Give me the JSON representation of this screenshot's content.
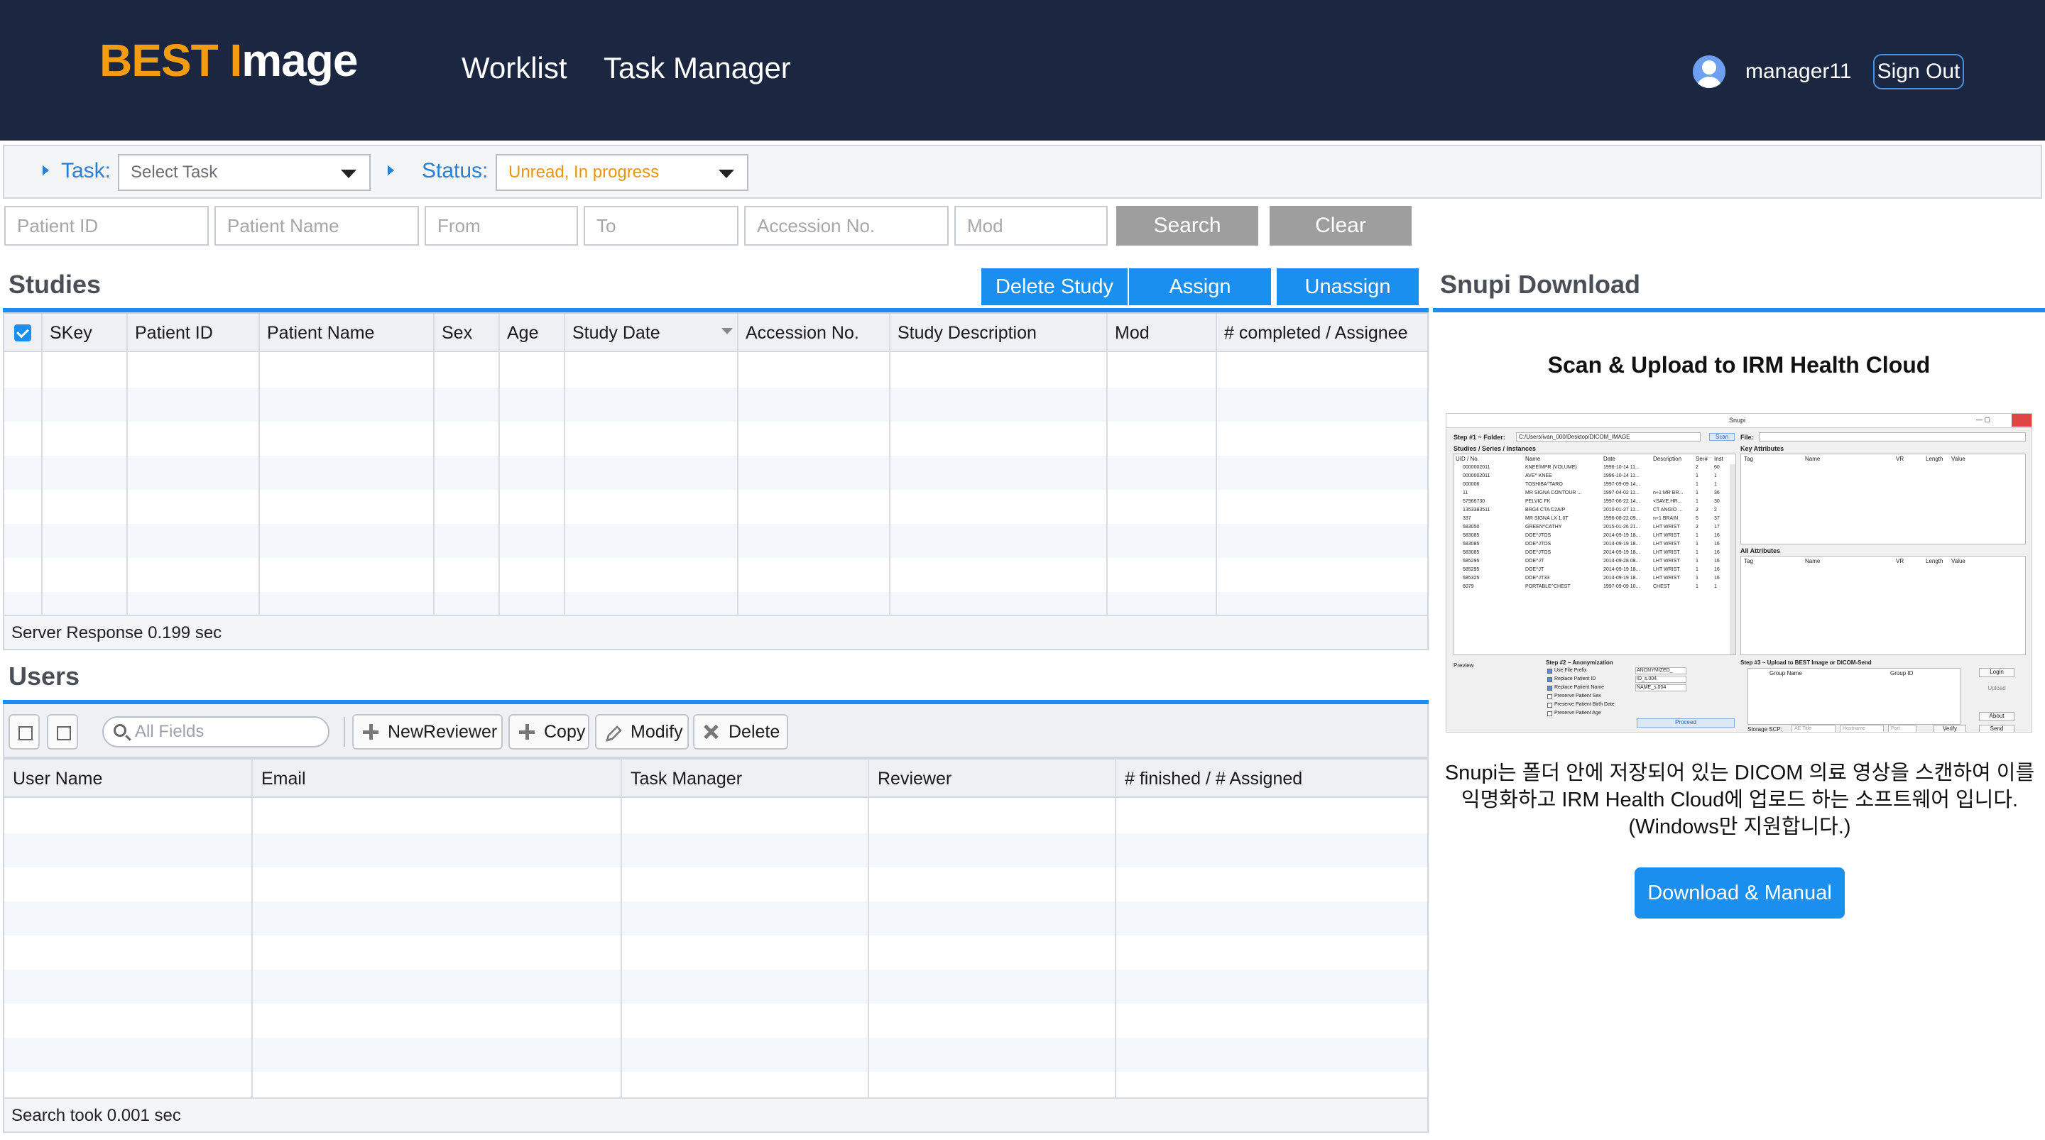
{
  "header": {
    "brand_part1": "BEST I",
    "brand_part2": "mage",
    "nav": [
      "Worklist",
      "Task Manager"
    ],
    "username": "manager11",
    "signout_label": "Sign Out",
    "colors": {
      "background": "#1b2640",
      "brand_orange": "#f39c12",
      "accent_blue": "#1a8ff0"
    }
  },
  "taskbar": {
    "task_label": "Task:",
    "task_value": "Select Task",
    "status_label": "Status:",
    "status_value": "Unread, In progress",
    "status_color": "#e8960c"
  },
  "filters": {
    "patient_id_placeholder": "Patient ID",
    "patient_name_placeholder": "Patient Name",
    "from_placeholder": "From",
    "to_placeholder": "To",
    "accession_placeholder": "Accession No.",
    "mod_placeholder": "Mod",
    "search_label": "Search",
    "clear_label": "Clear"
  },
  "studies": {
    "title": "Studies",
    "buttons": {
      "delete": "Delete Study",
      "assign": "Assign",
      "unassign": "Unassign"
    },
    "columns": [
      "SKey",
      "Patient ID",
      "Patient Name",
      "Sex",
      "Age",
      "Study Date",
      "Accession No.",
      "Study Description",
      "Mod",
      "# completed / Assignee"
    ],
    "footer": "Server Response 0.199 sec"
  },
  "users": {
    "title": "Users",
    "search_placeholder": "All Fields",
    "toolbar": {
      "new_reviewer": "NewReviewer",
      "copy": "Copy",
      "modify": "Modify",
      "delete": "Delete"
    },
    "columns": [
      "User Name",
      "Email",
      "Task Manager",
      "Reviewer",
      "# finished / # Assigned"
    ],
    "footer": "Search took 0.001 sec"
  },
  "snupi": {
    "title": "Snupi Download",
    "heading": "Scan & Upload to IRM Health Cloud",
    "description": "Snupi는 폴더 안에 저장되어 있는 DICOM 의료 영상을 스캔하여 이를 익명화하고 IRM Health Cloud에 업로드 하는 소프트웨어 입니다.(Windows만 지원합니다.)",
    "download_label": "Download & Manual",
    "screenshot": {
      "window_title": "Snupi",
      "step1_label": "Step #1 ~ Folder:",
      "folder_path": "C:/Users/ivan_000/Desktop/DICOM_IMAGE",
      "scan_label": "Scan",
      "file_label": "File:",
      "tree_label": "Studies / Series / Instances",
      "key_attributes": "Key Attributes",
      "all_attributes": "All Attributes",
      "tree_columns": [
        "UID / No.",
        "Name",
        "Date",
        "Description",
        "Ser#",
        "Inst"
      ],
      "attr_columns": [
        "Tag",
        "Name",
        "VR",
        "Length",
        "Value"
      ],
      "rows": [
        [
          "0000002011",
          "KNEE/MPR (VOLUME)",
          "1996-10-14 11...",
          "",
          "2",
          "60"
        ],
        [
          "0000002011",
          "AVE^ KNEE",
          "1996-10-14 11...",
          "",
          "1",
          "1"
        ],
        [
          "000006",
          "TOSHIBA^TARO",
          "1997-09-09 14...",
          "",
          "1",
          "1"
        ],
        [
          "11",
          "MR SIGNA CONTOUR ...",
          "1997-04-02 11...",
          "n+1 MR BR...",
          "1",
          "36"
        ],
        [
          "57966730",
          "PELVIC FK",
          "1997-06-22 14...",
          "<SAVE.HR...",
          "1",
          "30"
        ],
        [
          "1353383511",
          "BRG4 CTA C2A/P",
          "2010-01-27 11...",
          "CT ANGIO ...",
          "2",
          "2"
        ],
        [
          "337",
          "MR SIGNA LX 1.0T",
          "1996-08-22 09...",
          "n+1 BRAIN",
          "5",
          "37"
        ],
        [
          "583050",
          "GREEN^CATHY",
          "2015-01-26 21...",
          "LHT WRIST",
          "2",
          "17"
        ],
        [
          "583085",
          "DOE^JTOS",
          "2014-09-19 18...",
          "LHT WRIST",
          "1",
          "16"
        ],
        [
          "583085",
          "DOE^JTOS",
          "2014-09-19 18...",
          "LHT WRIST",
          "1",
          "16"
        ],
        [
          "583085",
          "DOE^JTOS",
          "2014-09-19 18...",
          "LHT WRIST",
          "1",
          "16"
        ],
        [
          "585295",
          "DOE^JT",
          "2014-09-28 08...",
          "LHT WRIST",
          "1",
          "16"
        ],
        [
          "585295",
          "DOE^JT",
          "2014-09-19 18...",
          "LHT WRIST",
          "1",
          "16"
        ],
        [
          "585325",
          "DOE^JT33",
          "2014-09-19 18...",
          "LHT WRIST",
          "1",
          "16"
        ],
        [
          "6079",
          "PORTABLE^CHEST",
          "1997-09-09 10...",
          "CHEST",
          "1",
          "1"
        ]
      ],
      "preview_label": "Preview",
      "step2_label": "Step #2 ~ Anonymization",
      "anon_options": [
        {
          "label": "Use File Prefix",
          "value": "ANONYMIZED_",
          "checked": true
        },
        {
          "label": "Replace Patient ID",
          "value": "ID_s.004",
          "checked": true
        },
        {
          "label": "Replace Patient Name",
          "value": "NAME_s.004",
          "checked": true
        },
        {
          "label": "Preserve Patient Sex",
          "value": "",
          "checked": false
        },
        {
          "label": "Preserve Patient Birth Date",
          "value": "",
          "checked": false
        },
        {
          "label": "Preserve Patient Age",
          "value": "",
          "checked": false
        }
      ],
      "proceed_label": "Proceed",
      "step3_label": "Step #3 ~ Upload to BEST Image or DICOM-Send",
      "group_name": "Group Name",
      "group_id": "Group ID",
      "login_label": "Login",
      "upload_label": "Upload",
      "about_label": "About",
      "storage_label": "Storage SCP:",
      "ae_title": "AE Title",
      "hostname": "Hostname",
      "port": "Port",
      "verify_label": "Verify",
      "send_label": "Send"
    }
  }
}
